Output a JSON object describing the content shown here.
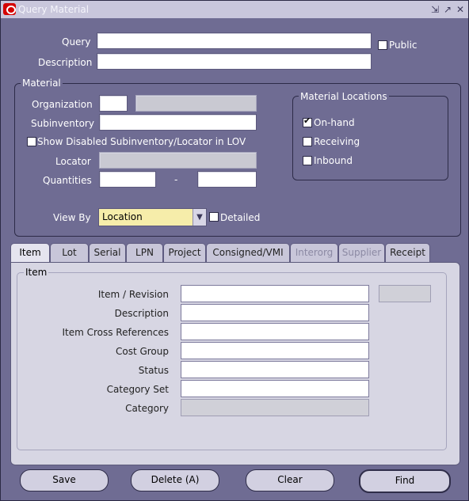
{
  "window": {
    "title": "Query Material"
  },
  "header": {
    "query_label": "Query",
    "public_label": "Public",
    "description_label": "Description"
  },
  "material": {
    "legend": "Material",
    "organization_label": "Organization",
    "subinventory_label": "Subinventory",
    "show_disabled_label": "Show Disabled Subinventory/Locator in LOV",
    "locator_label": "Locator",
    "quantities_label": "Quantities",
    "quantities_separator": "-",
    "view_by_label": "View By",
    "view_by_value": "Location",
    "detailed_label": "Detailed"
  },
  "locations": {
    "legend": "Material Locations",
    "items": [
      {
        "label": "On-hand",
        "checked": true
      },
      {
        "label": "Receiving",
        "checked": false
      },
      {
        "label": "Inbound",
        "checked": false
      }
    ]
  },
  "tabs": [
    {
      "label": "Item"
    },
    {
      "label": "Lot"
    },
    {
      "label": "Serial"
    },
    {
      "label": "LPN"
    },
    {
      "label": "Project"
    },
    {
      "label": "Consigned/VMI"
    },
    {
      "label": "Interorg"
    },
    {
      "label": "Supplier"
    },
    {
      "label": "Receipt"
    }
  ],
  "item_panel": {
    "legend": "Item",
    "fields": [
      {
        "label": "Item / Revision"
      },
      {
        "label": "Description"
      },
      {
        "label": "Item Cross References"
      },
      {
        "label": "Cost Group"
      },
      {
        "label": "Status"
      },
      {
        "label": "Category Set"
      },
      {
        "label": "Category"
      }
    ]
  },
  "buttons": {
    "save": "Save",
    "delete": "Delete (A)",
    "clear": "Clear",
    "find": "Find"
  }
}
